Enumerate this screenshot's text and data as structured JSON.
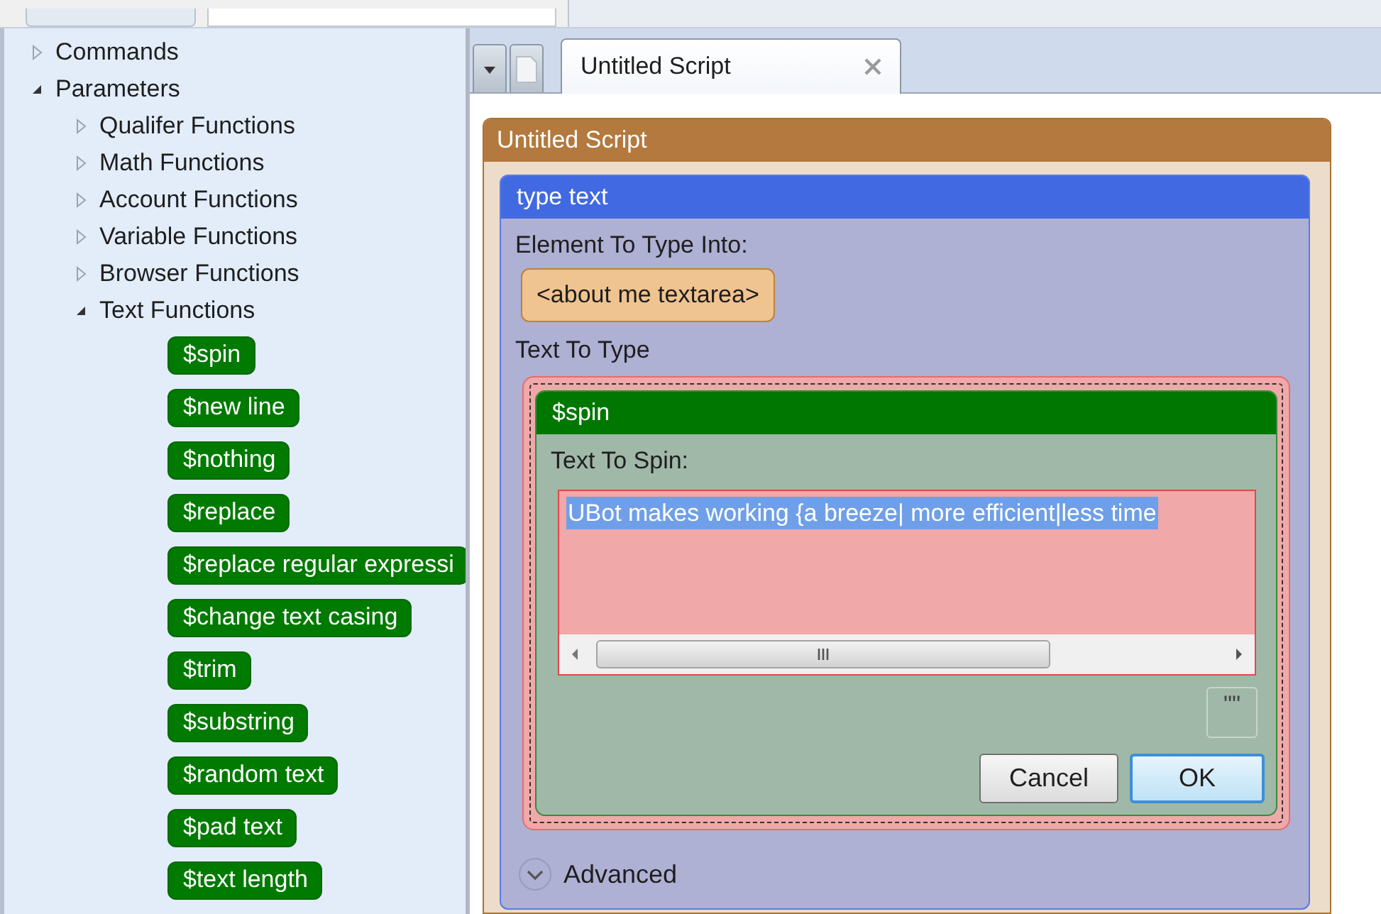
{
  "tree": [
    {
      "label": "Commands",
      "kind": "node",
      "expanded": false
    },
    {
      "label": "Parameters",
      "kind": "node",
      "expanded": true,
      "children": [
        {
          "label": "Qualifer Functions",
          "kind": "node",
          "expanded": false
        },
        {
          "label": "Math Functions",
          "kind": "node",
          "expanded": false
        },
        {
          "label": "Account Functions",
          "kind": "node",
          "expanded": false
        },
        {
          "label": "Variable Functions",
          "kind": "node",
          "expanded": false
        },
        {
          "label": "Browser Functions",
          "kind": "node",
          "expanded": false
        },
        {
          "label": "Text Functions",
          "kind": "node",
          "expanded": true,
          "children": [
            {
              "label": "$spin",
              "kind": "chip"
            },
            {
              "label": "$new line",
              "kind": "chip"
            },
            {
              "label": "$nothing",
              "kind": "chip"
            },
            {
              "label": "$replace",
              "kind": "chip"
            },
            {
              "label": "$replace regular expressi",
              "kind": "chip"
            },
            {
              "label": "$change text casing",
              "kind": "chip"
            },
            {
              "label": "$trim",
              "kind": "chip"
            },
            {
              "label": "$substring",
              "kind": "chip"
            },
            {
              "label": "$random text",
              "kind": "chip"
            },
            {
              "label": "$pad text",
              "kind": "chip"
            },
            {
              "label": "$text length",
              "kind": "chip"
            }
          ]
        }
      ]
    }
  ],
  "tabs": [
    {
      "label": "Untitled Script",
      "selected": true
    }
  ],
  "script": {
    "title": "Untitled Script",
    "command": {
      "title": "type text",
      "element_label": "Element To Type Into:",
      "element_value": "<about me textarea>",
      "text_label": "Text To Type",
      "parameter": {
        "title": "$spin",
        "field_label": "Text To Spin:",
        "value": "UBot makes working {a breeze| more efficient|less time",
        "value_selected": true,
        "more_button": "\"\"",
        "buttons": [
          {
            "label": "Cancel",
            "default": false
          },
          {
            "label": "OK",
            "default": true
          }
        ]
      },
      "advanced": {
        "label": "Advanced",
        "expanded": false
      }
    }
  }
}
